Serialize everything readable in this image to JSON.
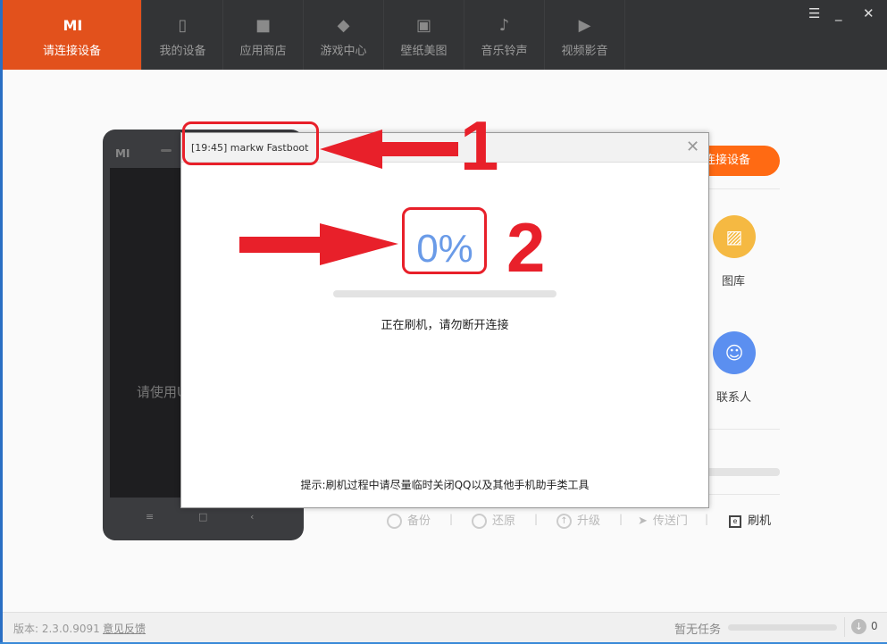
{
  "nav": {
    "tabs": [
      {
        "label": "请连接设备",
        "icon": "mi-logo"
      },
      {
        "label": "我的设备",
        "icon": "phone-icon"
      },
      {
        "label": "应用商店",
        "icon": "bag-icon"
      },
      {
        "label": "游戏中心",
        "icon": "gamepad-icon"
      },
      {
        "label": "壁纸美图",
        "icon": "picture-icon"
      },
      {
        "label": "音乐铃声",
        "icon": "music-icon"
      },
      {
        "label": "视频影音",
        "icon": "video-icon"
      }
    ],
    "logo": "MI"
  },
  "phone": {
    "logo": "MI",
    "hint": "请使用U"
  },
  "right": {
    "connect_label": "连接设备",
    "gallery": "图库",
    "contacts": "联系人",
    "gallery_color": "#f5b942",
    "contacts_color": "#5b8ff0"
  },
  "toolbar": {
    "backup": "备份",
    "restore": "还原",
    "upgrade": "升级",
    "transfer": "传送门",
    "flash": "刷机"
  },
  "footer": {
    "version": "版本: 2.3.0.9091",
    "feedback": "意见反馈",
    "tasks": "暂无任务",
    "download_count": "0"
  },
  "dialog": {
    "title": "[19:45] markw Fastboot",
    "percent": "0%",
    "progress": 0,
    "status": "正在刷机，请勿断开连接",
    "tip": "提示:刷机过程中请尽量临时关闭QQ以及其他手机助手类工具"
  },
  "annotations": {
    "one": "1",
    "two": "2"
  }
}
